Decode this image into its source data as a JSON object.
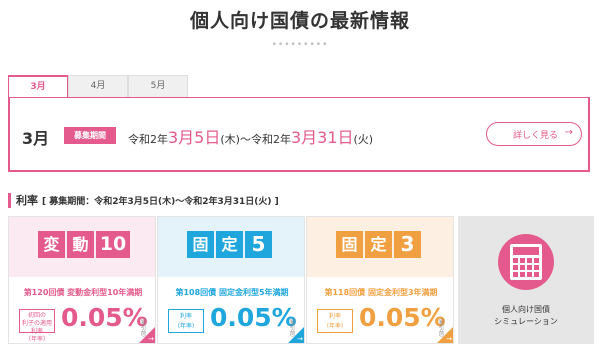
{
  "page": {
    "title": "個人向け国債の最新情報",
    "dots": "•••••••••"
  },
  "tabs": [
    {
      "label": "3月",
      "active": true
    },
    {
      "label": "4月",
      "active": false
    },
    {
      "label": "5月",
      "active": false
    }
  ],
  "period": {
    "month": "3月",
    "badge": "募集期間",
    "from_prefix": "令和2年",
    "from_date": "3月5日",
    "from_suffix": "(木)〜令和2年",
    "to_date": "3月31日",
    "to_suffix": "(火)",
    "detail_button": "詳しく見る",
    "detail_arrow": "→"
  },
  "rates": {
    "heading": "利率",
    "subheading": "[ 募集期間：令和2年3月5日(木)〜令和2年3月31日(火) ]",
    "cards": [
      {
        "logo1": "変",
        "logo2": "動",
        "logo_num": "10",
        "name": "第120回債 変動金利型10年満期",
        "rate_label_l1": "初回の",
        "rate_label_l2": "利子の適用利率",
        "rate_label_l3": "（年率）",
        "rate": "0.05%",
        "tiny": "（税引前）",
        "color": "#e45a8c"
      },
      {
        "logo1": "固",
        "logo2": "定",
        "logo_num": "5",
        "name": "第108回債 固定金利型5年満期",
        "rate_label_l1": "利率",
        "rate_label_l2": "（年率）",
        "rate_label_l3": "",
        "rate": "0.05%",
        "tiny": "（税引前）",
        "color": "#1ea6dd"
      },
      {
        "logo1": "固",
        "logo2": "定",
        "logo_num": "3",
        "name": "第118回債 固定金利型3年満期",
        "rate_label_l1": "利率",
        "rate_label_l2": "（年率）",
        "rate_label_l3": "",
        "rate": "0.05%",
        "tiny": "（税引前）",
        "color": "#f0a040"
      }
    ]
  },
  "simulation": {
    "line1": "個人向け国債",
    "line2": "シミュレーション",
    "icon": "calculator-icon"
  }
}
